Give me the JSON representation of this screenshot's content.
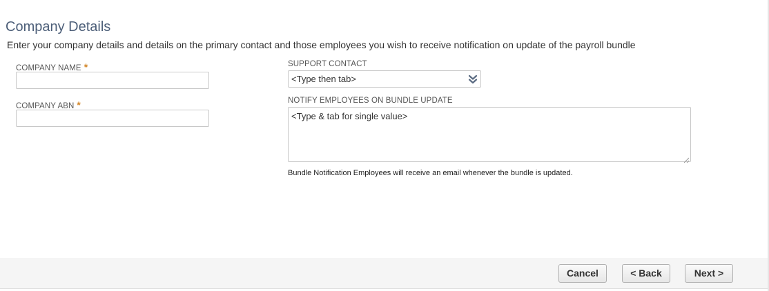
{
  "header": {
    "title": "Company Details",
    "description": "Enter your company details and details on the primary contact and those employees you wish to receive notification on update of the payroll bundle"
  },
  "form": {
    "company_name": {
      "label": "COMPANY NAME",
      "required_marker": "*",
      "value": ""
    },
    "company_abn": {
      "label": "COMPANY ABN",
      "required_marker": "*",
      "value": ""
    },
    "support_contact": {
      "label": "SUPPORT CONTACT",
      "value": "<Type then tab>",
      "icon": "double-chevron-down-icon"
    },
    "notify_employees": {
      "label": "NOTIFY EMPLOYEES ON BUNDLE UPDATE",
      "value": "<Type & tab for single value>",
      "help": "Bundle Notification Employees will receive an email whenever the bundle is updated."
    }
  },
  "footer": {
    "cancel_label": "Cancel",
    "back_label": "< Back",
    "next_label": "Next >"
  },
  "colors": {
    "title": "#4d5f79",
    "required": "#d3872a",
    "footer_bg": "#f5f5f5",
    "input_border": "#c8c8c8"
  }
}
